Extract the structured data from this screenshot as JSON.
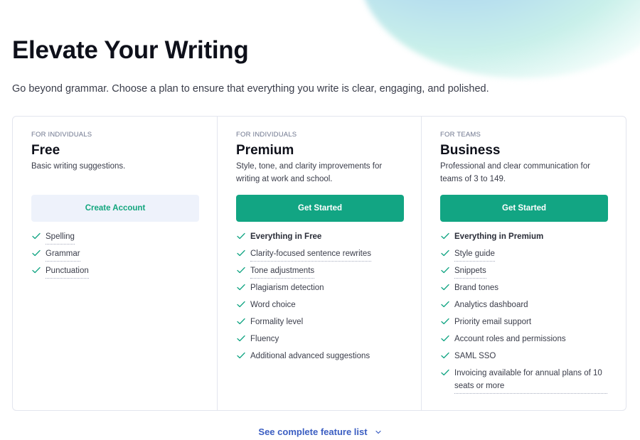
{
  "header": {
    "title": "Elevate Your Writing",
    "subtitle": "Go beyond grammar. Choose a plan to ensure that everything you write is clear, engaging, and polished."
  },
  "colors": {
    "brand_green": "#12a583",
    "link_blue": "#3b5ec2",
    "secondary_button_bg": "#eef2fb"
  },
  "plans": [
    {
      "audience": "FOR INDIVIDUALS",
      "name": "Free",
      "description": "Basic writing suggestions.",
      "button_label": "Create Account",
      "button_style": "secondary",
      "features": [
        {
          "label": "Spelling",
          "bold": false,
          "tooltip": true
        },
        {
          "label": "Grammar",
          "bold": false,
          "tooltip": true
        },
        {
          "label": "Punctuation",
          "bold": false,
          "tooltip": true
        }
      ]
    },
    {
      "audience": "FOR INDIVIDUALS",
      "name": "Premium",
      "description": "Style, tone, and clarity improvements for writing at work and school.",
      "button_label": "Get Started",
      "button_style": "primary",
      "features": [
        {
          "label": "Everything in Free",
          "bold": true,
          "tooltip": false
        },
        {
          "label": "Clarity-focused sentence rewrites",
          "bold": false,
          "tooltip": true
        },
        {
          "label": "Tone adjustments",
          "bold": false,
          "tooltip": true
        },
        {
          "label": "Plagiarism detection",
          "bold": false,
          "tooltip": false
        },
        {
          "label": "Word choice",
          "bold": false,
          "tooltip": false
        },
        {
          "label": "Formality level",
          "bold": false,
          "tooltip": false
        },
        {
          "label": "Fluency",
          "bold": false,
          "tooltip": false
        },
        {
          "label": "Additional advanced suggestions",
          "bold": false,
          "tooltip": false
        }
      ]
    },
    {
      "audience": "FOR TEAMS",
      "name": "Business",
      "description": "Professional and clear communication for teams of 3 to 149.",
      "button_label": "Get Started",
      "button_style": "primary",
      "features": [
        {
          "label": "Everything in Premium",
          "bold": true,
          "tooltip": false
        },
        {
          "label": "Style guide",
          "bold": false,
          "tooltip": true
        },
        {
          "label": "Snippets",
          "bold": false,
          "tooltip": true
        },
        {
          "label": "Brand tones",
          "bold": false,
          "tooltip": false
        },
        {
          "label": "Analytics dashboard",
          "bold": false,
          "tooltip": false
        },
        {
          "label": "Priority email support",
          "bold": false,
          "tooltip": false
        },
        {
          "label": "Account roles and permissions",
          "bold": false,
          "tooltip": false
        },
        {
          "label": "SAML SSO",
          "bold": false,
          "tooltip": false
        },
        {
          "label": "Invoicing available for annual plans of 10 seats or more",
          "bold": false,
          "tooltip": true
        }
      ]
    }
  ],
  "footer": {
    "see_more_label": "See complete feature list",
    "see_more_icon": "chevron-down-icon"
  }
}
